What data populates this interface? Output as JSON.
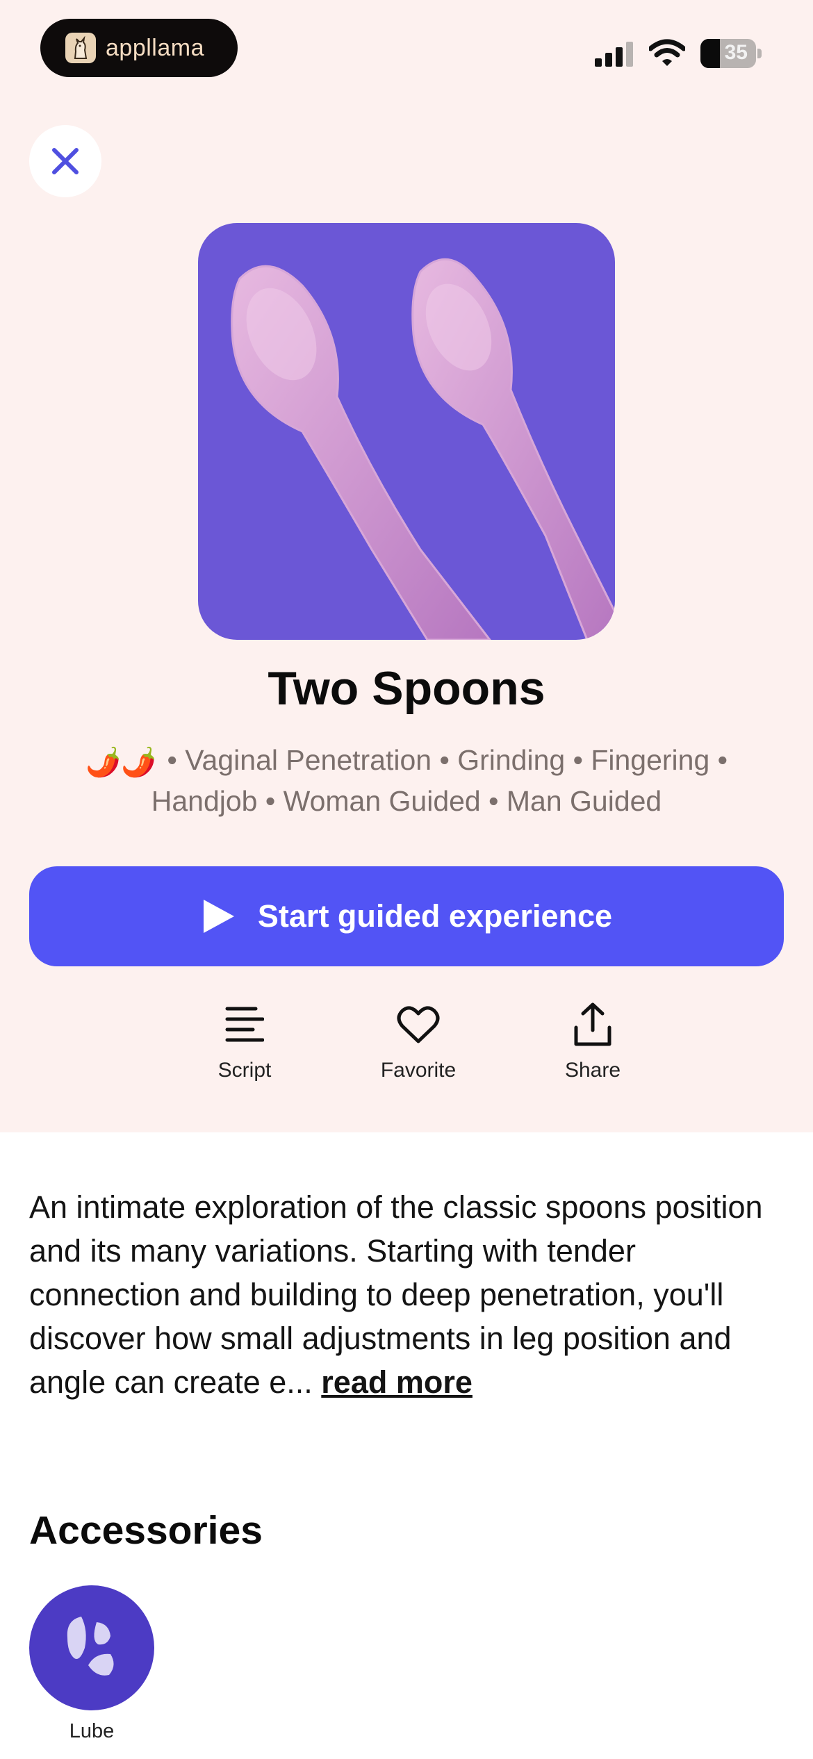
{
  "status_bar": {
    "brand": "appllama",
    "battery": "35",
    "battery_level": 0.35
  },
  "routine": {
    "title": "Two Spoons",
    "intensity_emoji": "🌶️🌶️",
    "tags_line1": "• Vaginal Penetration • Grinding • Fingering •",
    "tags_line2": "Handjob • Woman Guided • Man Guided"
  },
  "start_button": {
    "label": "Start guided experience"
  },
  "actions": [
    {
      "label": "Script",
      "icon": "script-lines-icon"
    },
    {
      "label": "Favorite",
      "icon": "heart-icon"
    },
    {
      "label": "Share",
      "icon": "share-icon"
    }
  ],
  "description": {
    "text": "An intimate exploration of the classic spoons position and its many variations. Starting with tender connection and building to deep penetration, you'll discover how small adjustments in leg position and angle can create e...",
    "more": "read more"
  },
  "accessories": {
    "title": "Accessories",
    "items": [
      {
        "label": "Lube",
        "icon": "lube-drops-icon"
      }
    ]
  },
  "colors": {
    "accent": "#5254f5",
    "hero_bg": "#6b57d6",
    "top_bg": "#fdf1ef"
  }
}
